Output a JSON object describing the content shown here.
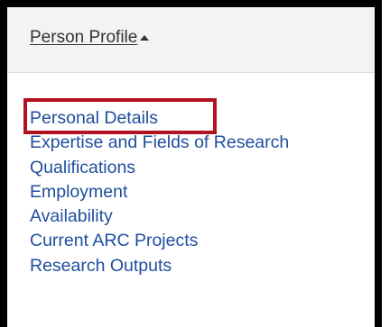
{
  "header": {
    "title": "Person Profile"
  },
  "nav": {
    "items": [
      {
        "label": "Personal Details"
      },
      {
        "label": "Expertise and Fields of Research"
      },
      {
        "label": "Qualifications"
      },
      {
        "label": "Employment"
      },
      {
        "label": "Availability"
      },
      {
        "label": "Current ARC Projects"
      },
      {
        "label": "Research Outputs"
      }
    ],
    "highlighted": "Personal Details"
  },
  "colors": {
    "link": "#1f4e9e",
    "highlight": "#b3111f",
    "header_bg": "#f3f3f3",
    "frame": "#000000"
  }
}
